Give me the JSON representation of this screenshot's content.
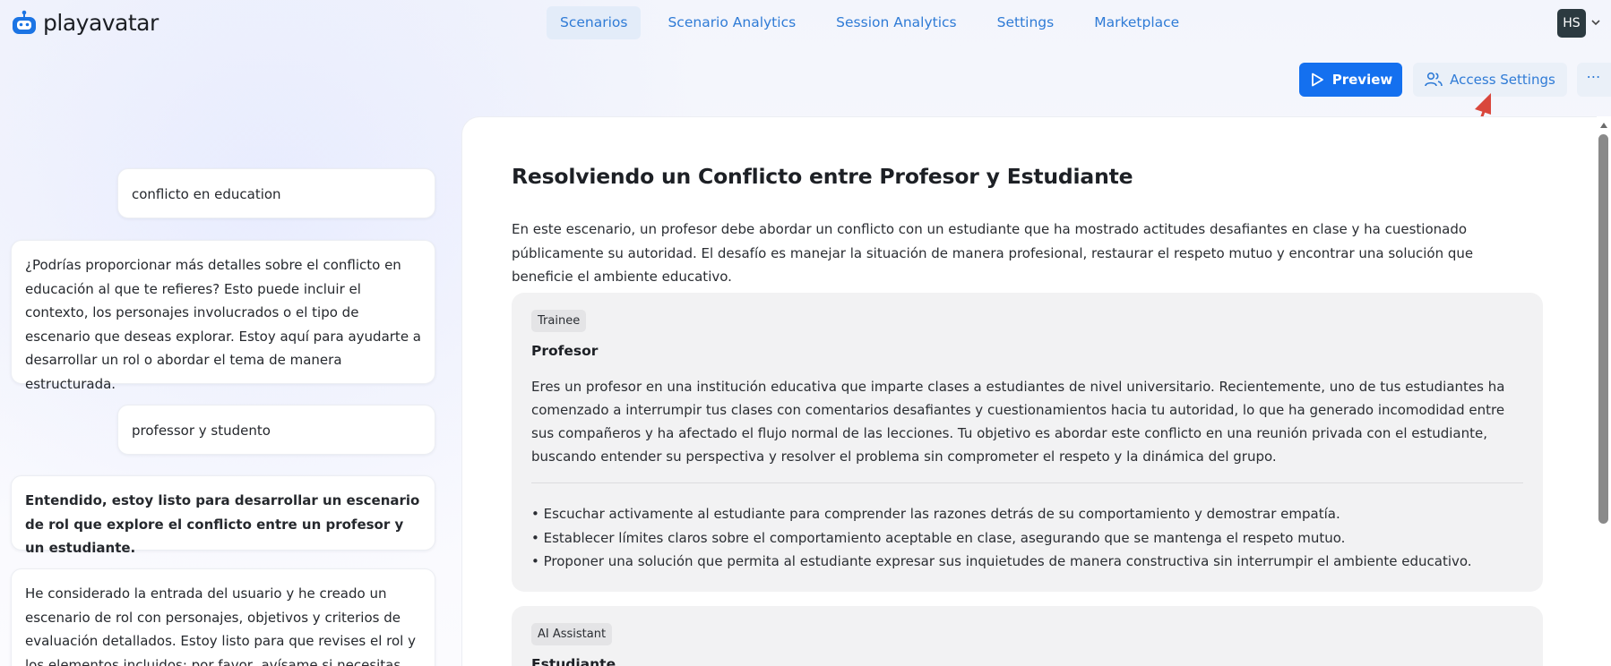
{
  "brand": {
    "name_part1": "play",
    "name_part2": "avatar",
    "logo_icon": "robot-face-icon"
  },
  "nav": {
    "items": [
      {
        "label": "Scenarios",
        "active": true
      },
      {
        "label": "Scenario Analytics",
        "active": false
      },
      {
        "label": "Session Analytics",
        "active": false
      },
      {
        "label": "Settings",
        "active": false
      },
      {
        "label": "Marketplace",
        "active": false
      }
    ]
  },
  "user": {
    "initials": "HS"
  },
  "actions": {
    "preview_label": "Preview",
    "access_label": "Access Settings",
    "more_label": "⋯"
  },
  "chat": {
    "messages": [
      {
        "role": "user",
        "text": "conflicto en education"
      },
      {
        "role": "assistant",
        "text": "¿Podrías proporcionar más detalles sobre el conflicto en educación al que te refieres? Esto puede incluir el contexto, los personajes involucrados o el tipo de escenario que deseas explorar. Estoy aquí para ayudarte a desarrollar un rol o abordar el tema de manera estructurada."
      },
      {
        "role": "user",
        "text": "professor y studento"
      },
      {
        "role": "assistant",
        "text": "Entendido, estoy listo para desarrollar un escenario de rol que explore el conflicto entre un profesor y un estudiante."
      },
      {
        "role": "assistant",
        "text": "He considerado la entrada del usuario y he creado un escenario de rol con personajes, objetivos y criterios de evaluación detallados. Estoy listo para que revises el rol y los elementos incluidos; por favor, avísame si necesitas algún"
      }
    ]
  },
  "scenario": {
    "title": "Resolviendo un Conflicto entre Profesor y Estudiante",
    "description": "En este escenario, un profesor debe abordar un conflicto con un estudiante que ha mostrado actitudes desafiantes en clase y ha cuestionado públicamente su autoridad. El desafío es manejar la situación de manera profesional, restaurar el respeto mutuo y encontrar una solución que beneficie el ambiente educativo.",
    "roles": [
      {
        "tag": "Trainee",
        "name": "Profesor",
        "text": "Eres un profesor en una institución educativa que imparte clases a estudiantes de nivel universitario. Recientemente, uno de tus estudiantes ha comenzado a interrumpir tus clases con comentarios desafiantes y cuestionamientos hacia tu autoridad, lo que ha generado incomodidad entre sus compañeros y ha afectado el flujo normal de las lecciones. Tu objetivo es abordar este conflicto en una reunión privada con el estudiante, buscando entender su perspectiva y resolver el problema sin comprometer el respeto y la dinámica del grupo.",
        "bullets": [
          "• Escuchar activamente al estudiante para comprender las razones detrás de su comportamiento y demostrar empatía.",
          "• Establecer límites claros sobre el comportamiento aceptable en clase, asegurando que se mantenga el respeto mutuo.",
          "• Proponer una solución que permita al estudiante expresar sus inquietudes de manera constructiva sin interrumpir el ambiente educativo."
        ]
      },
      {
        "tag": "AI Assistant",
        "name": "Estudiante"
      }
    ]
  },
  "colors": {
    "primary": "#1470ef",
    "link": "#2f7bd6",
    "annotation_arrow": "#d9473c"
  }
}
